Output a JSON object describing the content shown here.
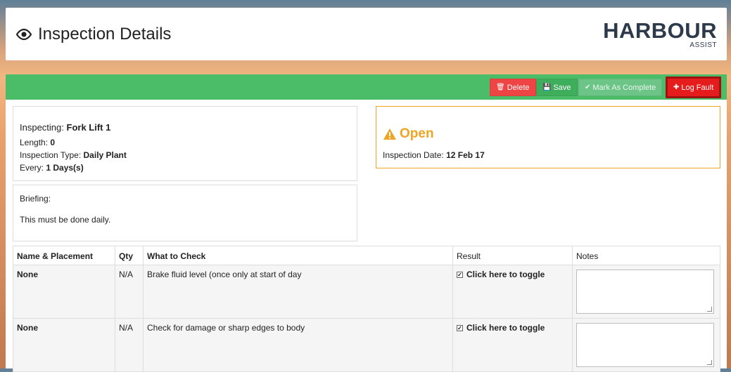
{
  "header": {
    "title": "Inspection Details",
    "logo_main": "HARBOUR",
    "logo_sub": "ASSIST"
  },
  "toolbar": {
    "delete_label": "Delete",
    "save_label": "Save",
    "complete_label": "Mark As Complete",
    "log_fault_label": "Log Fault"
  },
  "inspection": {
    "inspecting_label": "Inspecting:",
    "inspecting_value": "Fork Lift 1",
    "length_label": "Length:",
    "length_value": "0",
    "type_label": "Inspection Type:",
    "type_value": "Daily Plant",
    "every_label": "Every:",
    "every_value": "1 Days(s)"
  },
  "briefing": {
    "label": "Briefing:",
    "text": "This must be done daily."
  },
  "status": {
    "state": "Open",
    "date_label": "Inspection Date:",
    "date_value": "12 Feb 17"
  },
  "table": {
    "headers": [
      "Name & Placement",
      "Qty",
      "What to Check",
      "Result",
      "Notes"
    ],
    "rows": [
      {
        "name": "None",
        "qty": "N/A",
        "check": "Brake fluid level (once only at start of day",
        "result": "Click here to toggle"
      },
      {
        "name": "None",
        "qty": "N/A",
        "check": "Check for damage or sharp edges to body",
        "result": "Click here to toggle"
      }
    ]
  },
  "colors": {
    "toolbar_green": "#4bbd68",
    "delete_red": "#ee4444",
    "log_fault_red": "#e61b1b",
    "status_orange": "#f0a424"
  }
}
